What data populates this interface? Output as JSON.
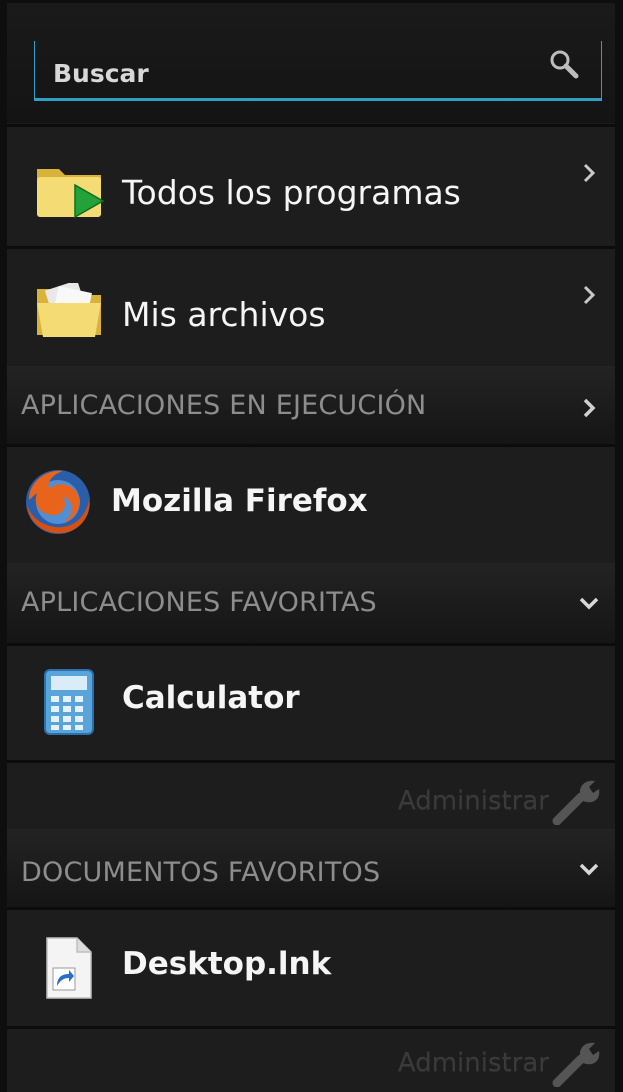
{
  "search": {
    "placeholder": "Buscar"
  },
  "menu": [
    {
      "label": "Todos los programas",
      "icon": "folder-play-icon"
    },
    {
      "label": "Mis archivos",
      "icon": "folder-documents-icon"
    }
  ],
  "running": {
    "header": "APLICACIONES EN EJECUCIÓN",
    "items": [
      {
        "label": "Mozilla Firefox",
        "icon": "firefox-icon"
      }
    ]
  },
  "favorite_apps": {
    "header": "APLICACIONES FAVORITAS",
    "items": [
      {
        "label": "Calculator",
        "icon": "calculator-icon"
      }
    ],
    "manage_label": "Administrar"
  },
  "favorite_docs": {
    "header": "DOCUMENTOS FAVORITOS",
    "items": [
      {
        "label": "Desktop.lnk",
        "icon": "shortcut-file-icon"
      }
    ],
    "manage_label": "Administrar"
  },
  "colors": {
    "accent": "#2f9fc4",
    "background": "#1d1d1d",
    "section_text": "#8d8d8d"
  }
}
